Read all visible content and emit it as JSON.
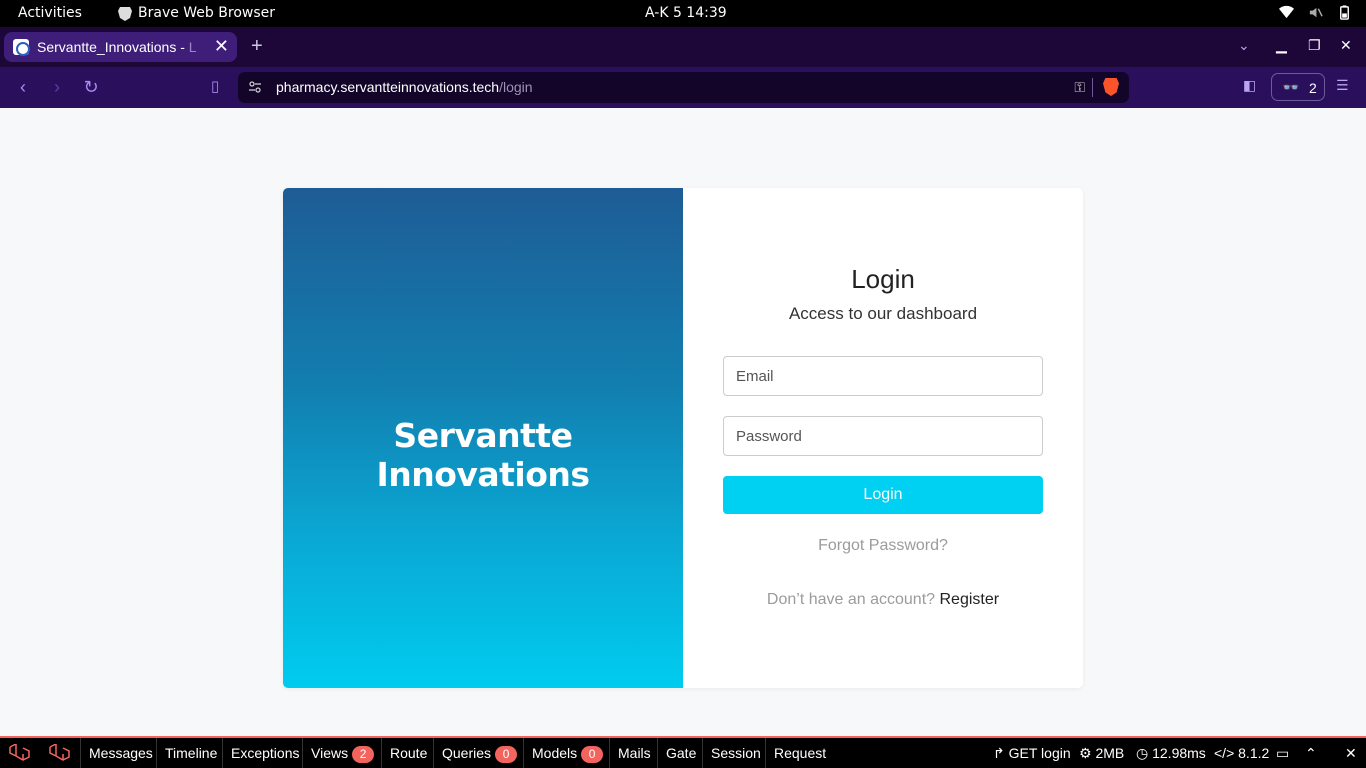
{
  "system": {
    "activities": "Activities",
    "app_name": "Brave Web Browser",
    "clock": "A-K 5  14:39"
  },
  "browser": {
    "tab_title": "Servantte_Innovations - ",
    "tab_title_faded": "L",
    "url_host": "pharmacy.servantteinnovations.tech",
    "url_path": "/login",
    "wallet_count": "2"
  },
  "login_page": {
    "brand": "Servantte Innovations",
    "title": "Login",
    "subtitle": "Access to our dashboard",
    "email_placeholder": "Email",
    "password_placeholder": "Password",
    "login_button": "Login",
    "forgot_password": "Forgot Password?",
    "no_account_text": "Don’t have an account?",
    "register_link": "Register"
  },
  "debugbar": {
    "tabs": [
      "Messages",
      "Timeline",
      "Exceptions",
      "Views",
      "Route",
      "Queries",
      "Models",
      "Mails",
      "Gate",
      "Session",
      "Request"
    ],
    "views_count": "2",
    "queries_count": "0",
    "models_count": "0",
    "route": "GET login",
    "memory": "2MB",
    "time": "12.98ms",
    "php_version": "8.1.2"
  },
  "colors": {
    "accent": "#00d0f2",
    "brand_gradient_top": "#1e5c95",
    "brand_gradient_bottom": "#00ccef",
    "debugbar_accent": "#f4645f"
  }
}
